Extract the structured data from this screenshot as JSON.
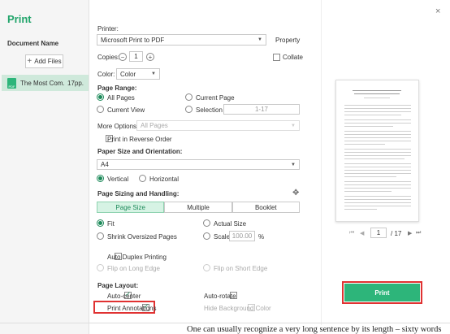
{
  "window": {
    "title": "Print",
    "close_glyph": "×"
  },
  "left": {
    "document_name": "Document Name",
    "add_files": "Add Files",
    "add_glyph": "+",
    "file": {
      "name": "The Most Com...",
      "pages": "17pp.",
      "icon_text": "PDF"
    }
  },
  "printer": {
    "label": "Printer:",
    "value": "Microsoft Print to PDF",
    "property": "Property",
    "copies_label": "Copies:",
    "copies_value": "1",
    "minus": "−",
    "plus": "+",
    "collate": "Collate",
    "color_label": "Color:",
    "color_value": "Color"
  },
  "page_range": {
    "label": "Page Range:",
    "all_pages": "All Pages",
    "current_page": "Current Page",
    "current_view": "Current View",
    "selection": "Selection",
    "selection_value": "1-17",
    "more_options_label": "More Options:",
    "more_options_value": "All Pages",
    "reverse": "Print in Reverse Order"
  },
  "paper": {
    "label": "Paper Size and Orientation:",
    "size": "A4",
    "vertical": "Vertical",
    "horizontal": "Horizontal"
  },
  "sizing": {
    "label": "Page Sizing and Handling:",
    "tabs": [
      "Page Size",
      "Multiple",
      "Booklet"
    ],
    "fit": "Fit",
    "actual_size": "Actual Size",
    "shrink": "Shrink Oversized Pages",
    "scale": "Scale",
    "scale_value": "100.00",
    "percent": "%",
    "duplex": "Auto Duplex Printing",
    "flip_long": "Flip on Long Edge",
    "flip_short": "Flip on Short Edge"
  },
  "layout": {
    "label": "Page Layout:",
    "auto_center": "Auto-center",
    "auto_rotate": "Auto-rotate",
    "print_annotations": "Print Annotations",
    "hide_bg": "Hide Background Color"
  },
  "preview": {
    "page_value": "1",
    "page_total": "/ 17",
    "first": "⏮",
    "prev": "◀",
    "next": "▶",
    "last": "⏭"
  },
  "print_button": "Print",
  "background_text": "One can usually recognize a very long sentence by its length – sixty words or"
}
